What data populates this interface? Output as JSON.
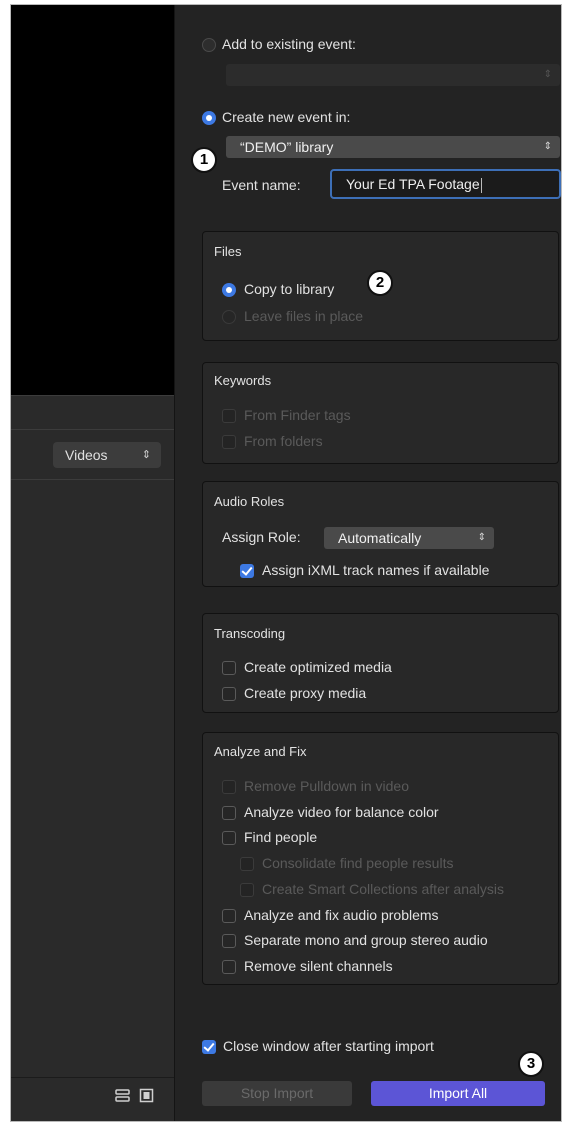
{
  "sidebar": {
    "videos_select": "Videos"
  },
  "destination": {
    "add_existing_label": "Add to existing event:",
    "existing_event_value": "",
    "create_new_label": "Create new event in:",
    "library_select": "“DEMO” library",
    "event_name_label": "Event name:",
    "event_name_value": "Your Ed TPA Footage"
  },
  "files": {
    "title": "Files",
    "copy_label": "Copy to library",
    "leave_label": "Leave files in place"
  },
  "keywords": {
    "title": "Keywords",
    "finder_tags_label": "From Finder tags",
    "folders_label": "From folders"
  },
  "audio_roles": {
    "title": "Audio Roles",
    "assign_role_label": "Assign Role:",
    "assign_role_value": "Automatically",
    "ixml_label": "Assign iXML track names if available"
  },
  "transcoding": {
    "title": "Transcoding",
    "optimized_label": "Create optimized media",
    "proxy_label": "Create proxy media"
  },
  "analyze": {
    "title": "Analyze and Fix",
    "pulldown_label": "Remove Pulldown in video",
    "balance_label": "Analyze video for balance color",
    "people_label": "Find people",
    "consolidate_label": "Consolidate find people results",
    "smart_label": "Create Smart Collections after analysis",
    "audio_problems_label": "Analyze and fix audio problems",
    "separate_label": "Separate mono and group stereo audio",
    "silent_label": "Remove silent channels"
  },
  "footer": {
    "close_window_label": "Close window after starting import",
    "stop_import_label": "Stop Import",
    "import_all_label": "Import All"
  },
  "callouts": {
    "one": "1",
    "two": "2",
    "three": "3"
  },
  "icons": {
    "list_view": "list-view-icon",
    "filmstrip_view": "filmstrip-view-icon",
    "chevron": "updown-chevron-icon"
  },
  "colors": {
    "accent_blue": "#3d79e3",
    "import_button": "#5c55d6",
    "panel_bg": "#232323",
    "group_bg": "#282828"
  }
}
